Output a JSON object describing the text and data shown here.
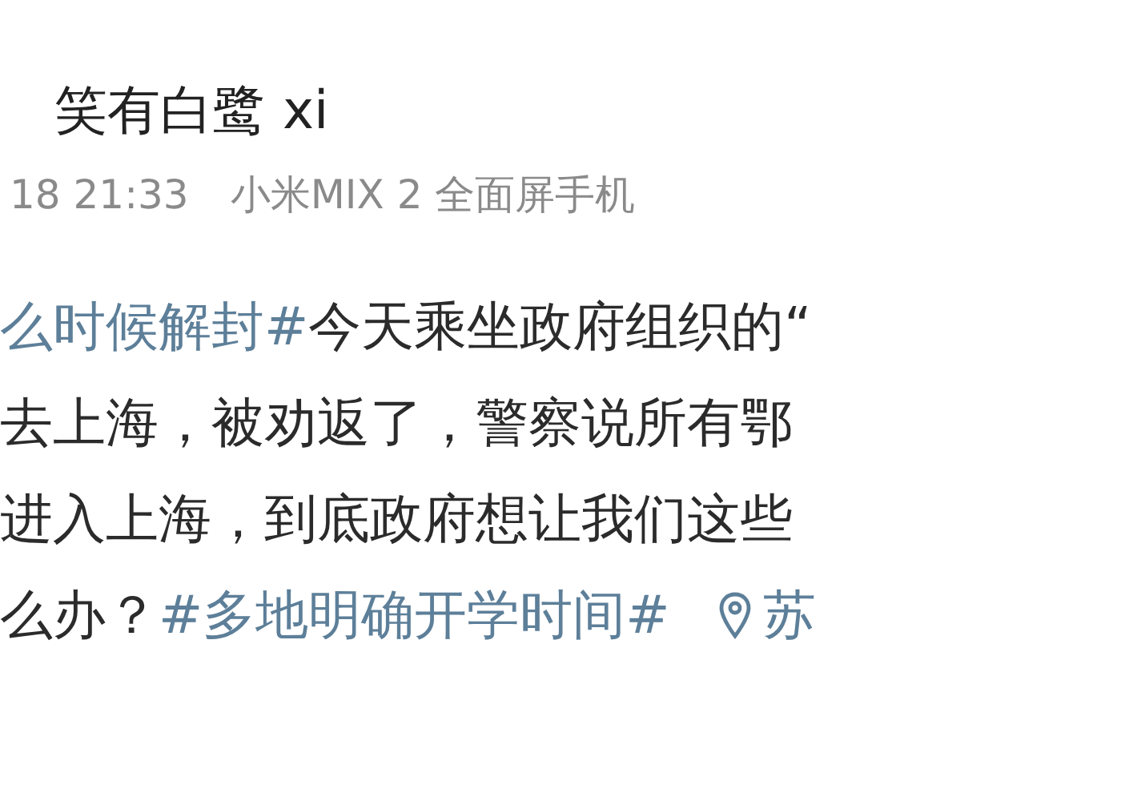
{
  "post": {
    "author": "笑有白鹭 xi",
    "time": "18 21:33",
    "device": "小米MIX 2 全面屏手机",
    "lines": [
      [
        {
          "kind": "topic",
          "text": "么时候解封#"
        },
        {
          "kind": "text",
          "text": "今天乘坐政府组织的“"
        }
      ],
      [
        {
          "kind": "text",
          "text": "去上海，被劝返了，警察说所有鄂"
        }
      ],
      [
        {
          "kind": "text",
          "text": "进入上海，到底政府想让我们这些"
        }
      ],
      [
        {
          "kind": "text",
          "text": "么办？"
        },
        {
          "kind": "topic",
          "text": "#多地明确开学时间#"
        }
      ]
    ],
    "location": "苏"
  }
}
